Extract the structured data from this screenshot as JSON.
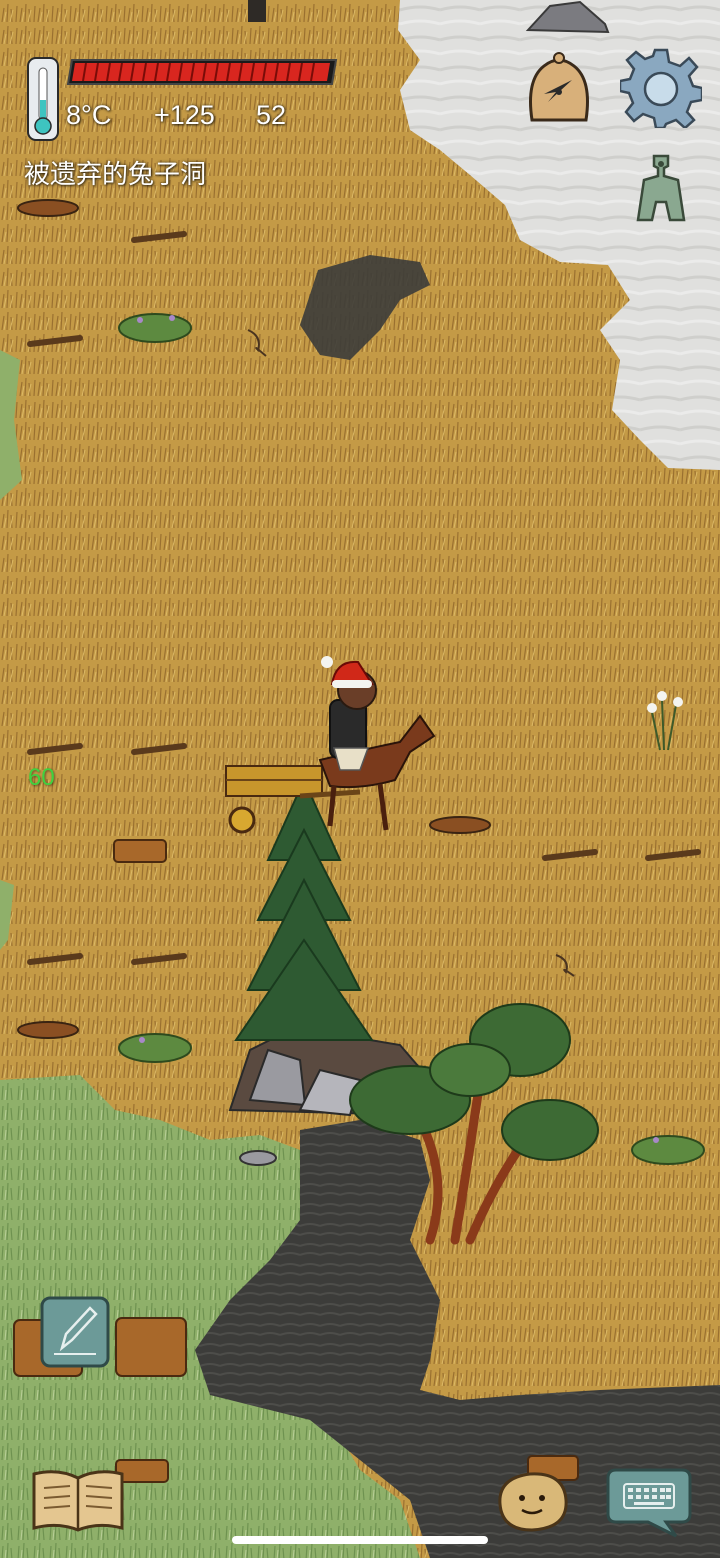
{
  "hud": {
    "temperature": "8°C",
    "score_delta": "+125",
    "age": "52",
    "location": "被遗弃的兔子洞",
    "health_fraction": 1.0,
    "temperature_fraction": 0.35
  },
  "world": {
    "counter": "60"
  },
  "controls": {
    "compass_icon": "compass-bell-icon",
    "settings_icon": "gear-icon",
    "coin_icon": "spade-coin-icon",
    "edit_icon": "pencil-note-icon",
    "journal_icon": "open-book-icon",
    "emote_icon": "potato-face-icon",
    "chat_icon": "keyboard-bubble-icon"
  },
  "colors": {
    "health_bar": "#d9261f",
    "counter": "#3fd23f",
    "grass": "#c39a45",
    "meadow": "#8fb06a",
    "fog": "#e2e2e0",
    "swamp": "#3a3a38"
  }
}
